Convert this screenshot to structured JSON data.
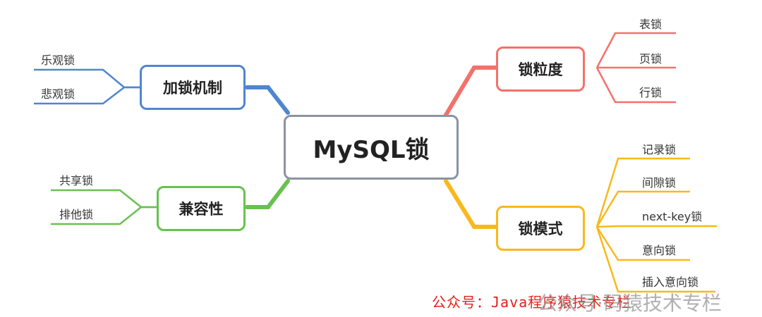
{
  "root": {
    "label": "MySQL锁"
  },
  "branches": {
    "lock_granularity": {
      "label": "锁粒度",
      "color": "#f4716a",
      "leaves": [
        "表锁",
        "页锁",
        "行锁"
      ]
    },
    "lock_mode": {
      "label": "锁模式",
      "color": "#f9b81c",
      "leaves": [
        "记录锁",
        "间隙锁",
        "next-key锁",
        "意向锁",
        "插入意向锁"
      ]
    },
    "locking_mechanism": {
      "label": "加锁机制",
      "color": "#4f86cf",
      "leaves": [
        "乐观锁",
        "悲观锁"
      ]
    },
    "compatibility": {
      "label": "兼容性",
      "color": "#69c14f",
      "leaves": [
        "共享锁",
        "排他锁"
      ]
    }
  },
  "watermark": {
    "text": "公众号：Java程序猿技术专栏",
    "overlay": "公众号·码猿技术专栏"
  }
}
